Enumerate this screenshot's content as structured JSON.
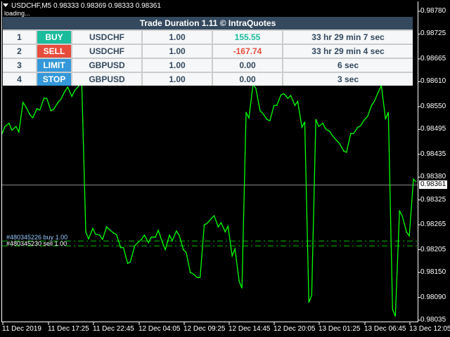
{
  "window": {
    "title": "USDCHF,M5  0.98333 0.98369 0.98333 0.98361",
    "loading": "loading..."
  },
  "panel": {
    "title": "Trade Duration 1.11 © IntraQuotes",
    "rows": [
      {
        "num": "1",
        "type": "BUY",
        "type_color": "#1abc9c",
        "symbol": "USDCHF",
        "lots": "1.00",
        "profit": "155.55",
        "profit_color": "#1abc9c",
        "duration": "33 hr 29 min 7 sec"
      },
      {
        "num": "2",
        "type": "SELL",
        "type_color": "#e74c3c",
        "symbol": "USDCHF",
        "lots": "1.00",
        "profit": "-167.74",
        "profit_color": "#e74c3c",
        "duration": "33 hr 29 min 4 sec"
      },
      {
        "num": "3",
        "type": "LIMIT",
        "type_color": "#3498db",
        "symbol": "GBPUSD",
        "lots": "1.00",
        "profit": "0.00",
        "profit_color": "#34495e",
        "duration": "6 sec"
      },
      {
        "num": "4",
        "type": "STOP",
        "type_color": "#3498db",
        "symbol": "GBPUSD",
        "lots": "1.00",
        "profit": "0.00",
        "profit_color": "#34495e",
        "duration": "3 sec"
      }
    ]
  },
  "chart_data": {
    "type": "line",
    "symbol": "USDCHF,M5",
    "line_color": "#00ff00",
    "current_price": "0.98361",
    "price_labels": [
      "0.98780",
      "0.98725",
      "0.98665",
      "0.98610",
      "0.98550",
      "0.98495",
      "0.98435",
      "0.98380",
      "0.98325",
      "0.98265",
      "0.98205",
      "0.98150",
      "0.98090",
      "0.98035"
    ],
    "time_labels": [
      "11 Dec 2019",
      "11 Dec 17:25",
      "11 Dec 22:45",
      "12 Dec 04:05",
      "12 Dec 09:25",
      "12 Dec 14:45",
      "12 Dec 20:05",
      "13 Dec 01:25",
      "13 Dec 06:45",
      "13 Dec 12:05"
    ],
    "ylim": [
      0.98035,
      0.9878
    ],
    "values": [
      0.98485,
      0.9851,
      0.98502,
      0.9856,
      0.9853,
      0.98545,
      0.9857,
      0.9854,
      0.9856,
      0.98587,
      0.98575,
      0.986,
      0.98248,
      0.98256,
      0.9824,
      0.9826,
      0.98245,
      0.9821,
      0.98172,
      0.98214,
      0.9823,
      0.98222,
      0.98235,
      0.98222,
      0.9824,
      0.9825,
      0.98205,
      0.9815,
      0.98138,
      0.98265,
      0.9828,
      0.9826,
      0.98248,
      0.9819,
      0.98129,
      0.98536,
      0.98604,
      0.9854,
      0.98519,
      0.98553,
      0.98578,
      0.9857,
      0.98553,
      0.985,
      0.98078,
      0.98519,
      0.9851,
      0.9849,
      0.98468,
      0.98443,
      0.98485,
      0.985,
      0.98519,
      0.98553,
      0.98587,
      0.9852,
      0.98061,
      0.98299,
      0.98248,
      0.98375
    ],
    "orders": [
      {
        "label": "#480345226 buy 1.00",
        "price": 0.98226
      },
      {
        "label": "#480345230 sell 1.00",
        "price": 0.98214
      }
    ]
  }
}
